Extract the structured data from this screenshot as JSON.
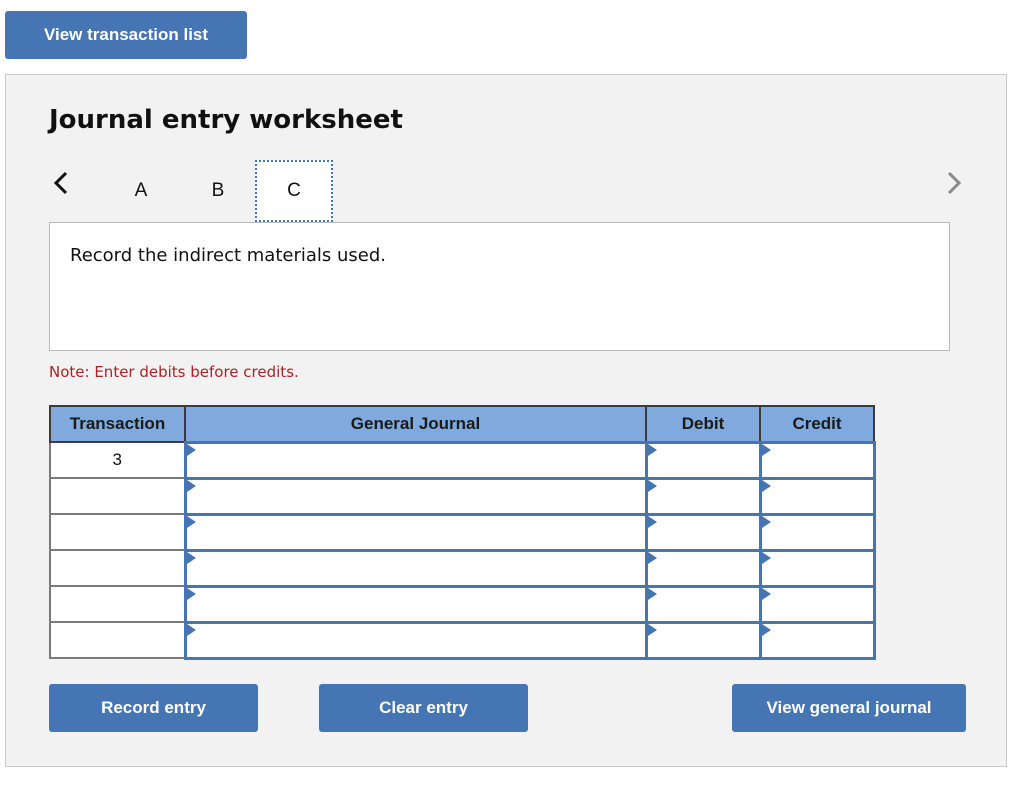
{
  "top_button": {
    "label": "View transaction list"
  },
  "worksheet": {
    "title": "Journal entry worksheet",
    "nav": {
      "prev_icon": "chevron-left-icon",
      "next_icon": "chevron-right-icon"
    },
    "tabs": [
      {
        "label": "A",
        "active": false
      },
      {
        "label": "B",
        "active": false
      },
      {
        "label": "C",
        "active": true
      }
    ],
    "description": "Record the indirect materials used.",
    "note": "Note: Enter debits before credits.",
    "table": {
      "headers": [
        "Transaction",
        "General Journal",
        "Debit",
        "Credit"
      ],
      "rows": [
        {
          "transaction": "3",
          "account": "",
          "debit": "",
          "credit": ""
        },
        {
          "transaction": "",
          "account": "",
          "debit": "",
          "credit": ""
        },
        {
          "transaction": "",
          "account": "",
          "debit": "",
          "credit": ""
        },
        {
          "transaction": "",
          "account": "",
          "debit": "",
          "credit": ""
        },
        {
          "transaction": "",
          "account": "",
          "debit": "",
          "credit": ""
        },
        {
          "transaction": "",
          "account": "",
          "debit": "",
          "credit": ""
        }
      ]
    },
    "buttons": {
      "record": "Record entry",
      "clear": "Clear entry",
      "view_general_journal": "View general journal"
    }
  },
  "colors": {
    "button": "#4675b4",
    "header": "#80a9dd",
    "note": "#a82424",
    "panel": "#f2f2f2"
  }
}
